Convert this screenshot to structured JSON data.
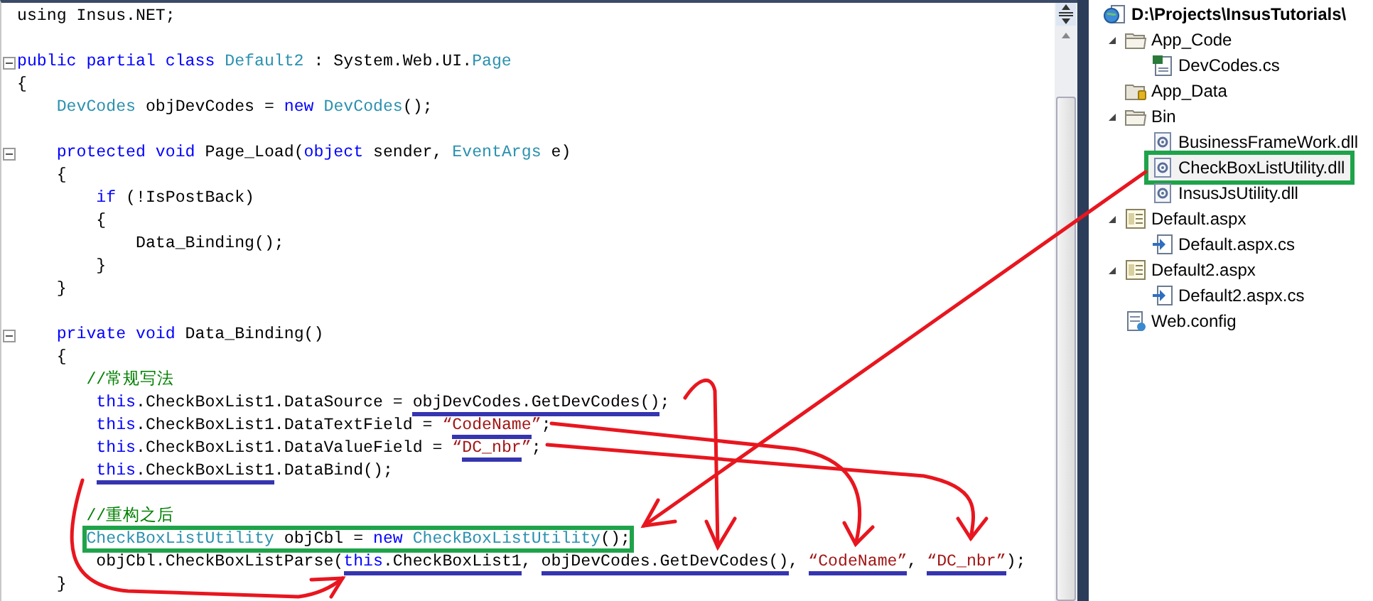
{
  "editor": {
    "lines": [
      {
        "kind": "code",
        "foldable": false,
        "boxed": false,
        "tokens": [
          {
            "text": "using Insus.NET;",
            "kind": "plain",
            "underlined": false
          }
        ]
      },
      {
        "kind": "blank"
      },
      {
        "kind": "code",
        "foldable": true,
        "boxed": false,
        "tokens": [
          {
            "text": "public partial class ",
            "kind": "keyword",
            "underlined": false
          },
          {
            "text": "Default2",
            "kind": "type",
            "underlined": false
          },
          {
            "text": " : System.Web.UI.",
            "kind": "plain",
            "underlined": false
          },
          {
            "text": "Page",
            "kind": "type",
            "underlined": false
          }
        ]
      },
      {
        "kind": "code",
        "foldable": false,
        "boxed": false,
        "tokens": [
          {
            "text": "{",
            "kind": "plain",
            "underlined": false
          }
        ]
      },
      {
        "kind": "code",
        "foldable": false,
        "boxed": false,
        "tokens": [
          {
            "text": "    DevCodes",
            "kind": "type",
            "underlined": false
          },
          {
            "text": " objDevCodes = ",
            "kind": "plain",
            "underlined": false
          },
          {
            "text": "new ",
            "kind": "keyword",
            "underlined": false
          },
          {
            "text": "DevCodes",
            "kind": "type",
            "underlined": false
          },
          {
            "text": "();",
            "kind": "plain",
            "underlined": false
          }
        ]
      },
      {
        "kind": "blank"
      },
      {
        "kind": "code",
        "foldable": true,
        "boxed": false,
        "tokens": [
          {
            "text": "    protected void",
            "kind": "keyword",
            "underlined": false
          },
          {
            "text": " Page_Load(",
            "kind": "plain",
            "underlined": false
          },
          {
            "text": "object",
            "kind": "keyword",
            "underlined": false
          },
          {
            "text": " sender, ",
            "kind": "plain",
            "underlined": false
          },
          {
            "text": "EventArgs",
            "kind": "type",
            "underlined": false
          },
          {
            "text": " e)",
            "kind": "plain",
            "underlined": false
          }
        ]
      },
      {
        "kind": "code",
        "foldable": false,
        "boxed": false,
        "tokens": [
          {
            "text": "    {",
            "kind": "plain",
            "underlined": false
          }
        ]
      },
      {
        "kind": "code",
        "foldable": false,
        "boxed": false,
        "tokens": [
          {
            "text": "        if",
            "kind": "keyword",
            "underlined": false
          },
          {
            "text": " (!IsPostBack)",
            "kind": "plain",
            "underlined": false
          }
        ]
      },
      {
        "kind": "code",
        "foldable": false,
        "boxed": false,
        "tokens": [
          {
            "text": "        {",
            "kind": "plain",
            "underlined": false
          }
        ]
      },
      {
        "kind": "code",
        "foldable": false,
        "boxed": false,
        "tokens": [
          {
            "text": "            Data_Binding();",
            "kind": "plain",
            "underlined": false
          }
        ]
      },
      {
        "kind": "code",
        "foldable": false,
        "boxed": false,
        "tokens": [
          {
            "text": "        }",
            "kind": "plain",
            "underlined": false
          }
        ]
      },
      {
        "kind": "code",
        "foldable": false,
        "boxed": false,
        "tokens": [
          {
            "text": "    }",
            "kind": "plain",
            "underlined": false
          }
        ]
      },
      {
        "kind": "blank"
      },
      {
        "kind": "code",
        "foldable": true,
        "boxed": false,
        "tokens": [
          {
            "text": "    private void",
            "kind": "keyword",
            "underlined": false
          },
          {
            "text": " Data_Binding()",
            "kind": "plain",
            "underlined": false
          }
        ]
      },
      {
        "kind": "code",
        "foldable": false,
        "boxed": false,
        "tokens": [
          {
            "text": "    {",
            "kind": "plain",
            "underlined": false
          }
        ]
      },
      {
        "kind": "code",
        "foldable": false,
        "boxed": false,
        "tokens": [
          {
            "text": "       //常规写法",
            "kind": "comment",
            "underlined": false
          }
        ]
      },
      {
        "kind": "code",
        "foldable": false,
        "boxed": false,
        "tokens": [
          {
            "text": "        this",
            "kind": "keyword",
            "underlined": false
          },
          {
            "text": ".CheckBoxList1.DataSource = ",
            "kind": "plain",
            "underlined": false
          },
          {
            "text": "objDevCodes.GetDevCodes()",
            "kind": "plain",
            "underlined": true
          },
          {
            "text": ";",
            "kind": "plain",
            "underlined": false
          }
        ]
      },
      {
        "kind": "code",
        "foldable": false,
        "boxed": false,
        "tokens": [
          {
            "text": "        this",
            "kind": "keyword",
            "underlined": false
          },
          {
            "text": ".CheckBoxList1.DataTextField = ",
            "kind": "plain",
            "underlined": false
          },
          {
            "text": "“",
            "kind": "string",
            "underlined": false
          },
          {
            "text": "CodeName",
            "kind": "string",
            "underlined": true
          },
          {
            "text": "”",
            "kind": "string",
            "underlined": false
          },
          {
            "text": ";",
            "kind": "plain",
            "underlined": false
          }
        ]
      },
      {
        "kind": "code",
        "foldable": false,
        "boxed": false,
        "tokens": [
          {
            "text": "        this",
            "kind": "keyword",
            "underlined": false
          },
          {
            "text": ".CheckBoxList1.DataValueField = ",
            "kind": "plain",
            "underlined": false
          },
          {
            "text": "“",
            "kind": "string",
            "underlined": false
          },
          {
            "text": "DC_nbr",
            "kind": "string",
            "underlined": true
          },
          {
            "text": "”",
            "kind": "string",
            "underlined": false
          },
          {
            "text": ";",
            "kind": "plain",
            "underlined": false
          }
        ]
      },
      {
        "kind": "code",
        "foldable": false,
        "boxed": false,
        "tokens": [
          {
            "text": "        this",
            "kind": "keyword",
            "underlined": true
          },
          {
            "text": ".CheckBoxList1",
            "kind": "plain",
            "underlined": true
          },
          {
            "text": ".DataBind();",
            "kind": "plain",
            "underlined": false
          }
        ]
      },
      {
        "kind": "blank"
      },
      {
        "kind": "code",
        "foldable": false,
        "boxed": false,
        "tokens": [
          {
            "text": "       //重构之后",
            "kind": "comment",
            "underlined": false
          }
        ]
      },
      {
        "kind": "code",
        "foldable": false,
        "boxed": true,
        "tokens": [
          {
            "text": "       CheckBoxListUtility",
            "kind": "type",
            "underlined": false
          },
          {
            "text": " objCbl = ",
            "kind": "plain",
            "underlined": false
          },
          {
            "text": "new ",
            "kind": "keyword",
            "underlined": false
          },
          {
            "text": "CheckBoxListUtility",
            "kind": "type",
            "underlined": false
          },
          {
            "text": "();",
            "kind": "plain",
            "underlined": false
          }
        ]
      },
      {
        "kind": "code",
        "foldable": false,
        "boxed": false,
        "tokens": [
          {
            "text": "        objCbl.CheckBoxListParse(",
            "kind": "plain",
            "underlined": false
          },
          {
            "text": "this",
            "kind": "keyword",
            "underlined": true
          },
          {
            "text": ".CheckBoxList1",
            "kind": "plain",
            "underlined": true
          },
          {
            "text": ", ",
            "kind": "plain",
            "underlined": false
          },
          {
            "text": "objDevCodes.GetDevCodes()",
            "kind": "plain",
            "underlined": true
          },
          {
            "text": ", ",
            "kind": "plain",
            "underlined": false
          },
          {
            "text": "“CodeName”",
            "kind": "string",
            "underlined": true
          },
          {
            "text": ", ",
            "kind": "plain",
            "underlined": false
          },
          {
            "text": "“DC_nbr”",
            "kind": "string",
            "underlined": true
          },
          {
            "text": ");",
            "kind": "plain",
            "underlined": false
          }
        ]
      },
      {
        "kind": "code",
        "foldable": false,
        "boxed": false,
        "tokens": [
          {
            "text": "    }",
            "kind": "plain",
            "underlined": false
          }
        ]
      }
    ]
  },
  "solution_explorer": {
    "root": {
      "label": "D:\\Projects\\InsusTutorials\\",
      "items": [
        {
          "label": "App_Code",
          "kind": "folder",
          "expanded": true,
          "highlighted": false,
          "children": [
            {
              "label": "DevCodes.cs",
              "kind": "csharp",
              "highlighted": false
            }
          ]
        },
        {
          "label": "App_Data",
          "kind": "data-folder",
          "highlighted": false
        },
        {
          "label": "Bin",
          "kind": "folder",
          "expanded": true,
          "highlighted": false,
          "children": [
            {
              "label": "BusinessFrameWork.dll",
              "kind": "dll",
              "highlighted": false
            },
            {
              "label": "CheckBoxListUtility.dll",
              "kind": "dll",
              "highlighted": true
            },
            {
              "label": "InsusJsUtility.dll",
              "kind": "dll",
              "highlighted": false
            }
          ]
        },
        {
          "label": "Default.aspx",
          "kind": "page",
          "expanded": true,
          "highlighted": false,
          "children": [
            {
              "label": "Default.aspx.cs",
              "kind": "codebehind",
              "highlighted": false
            }
          ]
        },
        {
          "label": "Default2.aspx",
          "kind": "page",
          "expanded": true,
          "highlighted": false,
          "children": [
            {
              "label": "Default2.aspx.cs",
              "kind": "codebehind",
              "highlighted": false
            }
          ]
        },
        {
          "label": "Web.config",
          "kind": "config",
          "highlighted": false
        }
      ]
    }
  }
}
